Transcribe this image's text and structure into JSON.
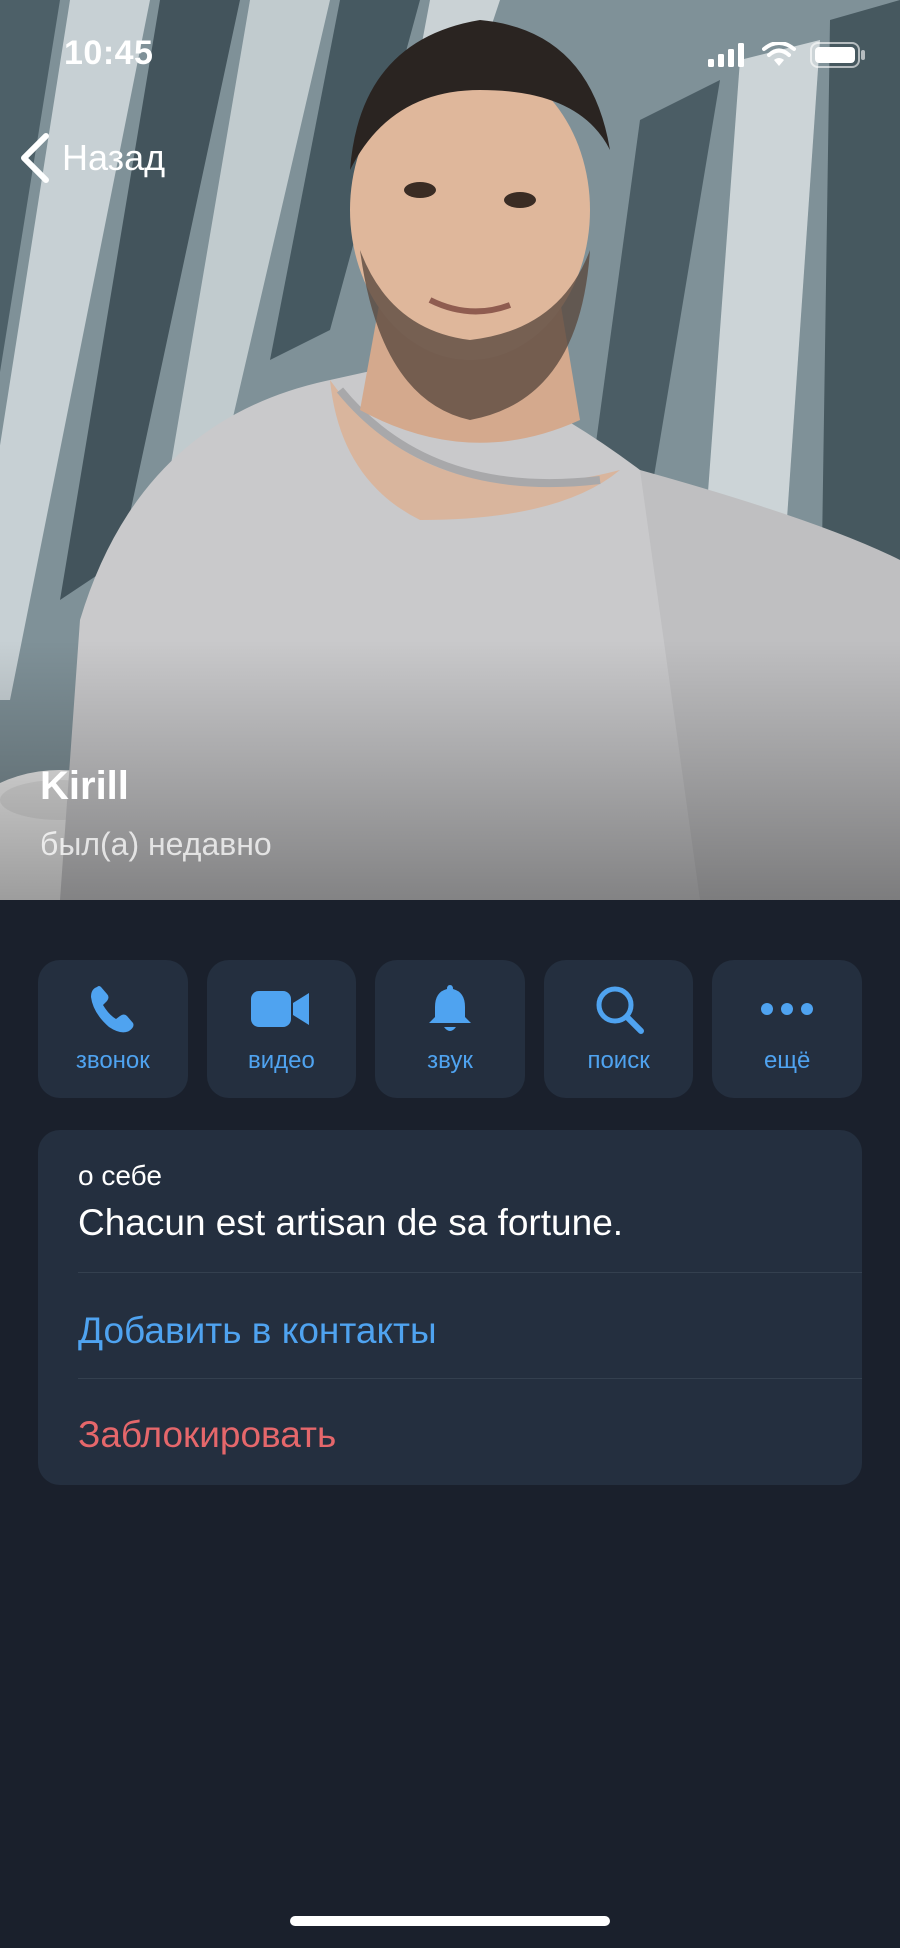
{
  "status_bar": {
    "time": "10:45",
    "icons": [
      "signal-icon",
      "wifi-icon",
      "battery-icon"
    ]
  },
  "nav": {
    "back_label": "Назад"
  },
  "profile": {
    "name": "Kirill",
    "status": "был(а) недавно"
  },
  "actions": [
    {
      "label": "звонок",
      "icon": "phone-icon"
    },
    {
      "label": "видео",
      "icon": "video-camera-icon"
    },
    {
      "label": "звук",
      "icon": "bell-icon"
    },
    {
      "label": "поиск",
      "icon": "search-icon"
    },
    {
      "label": "ещё",
      "icon": "more-dots-icon"
    }
  ],
  "info": {
    "about_label": "о себе",
    "about_text": "Chacun est artisan de sa fortune.",
    "add_contact": "Добавить в контакты",
    "block": "Заблокировать"
  },
  "colors": {
    "background": "#1a202c",
    "card": "#242f3f",
    "accent": "#4fa3f0",
    "danger": "#e5676b"
  }
}
